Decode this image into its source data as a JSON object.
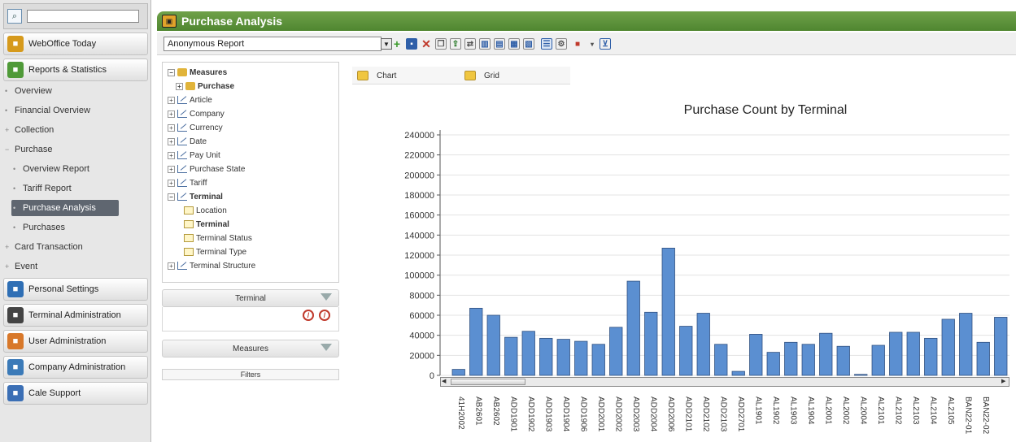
{
  "sidebar": {
    "search_value": "",
    "sections": [
      {
        "label": "WebOffice Today",
        "icon": "weboffice-icon",
        "color": "#d69a1c"
      },
      {
        "label": "Reports & Statistics",
        "icon": "bar-chart-icon",
        "color": "#4f9a38"
      }
    ],
    "sub_items": [
      {
        "label": "Overview",
        "level": 1
      },
      {
        "label": "Financial Overview",
        "level": 1
      },
      {
        "label": "Collection",
        "level": 1,
        "expand": "+"
      },
      {
        "label": "Purchase",
        "level": 1,
        "expand": "-"
      },
      {
        "label": "Overview Report",
        "level": 2
      },
      {
        "label": "Tariff Report",
        "level": 2
      },
      {
        "label": "Purchase Analysis",
        "level": 2,
        "active": true
      },
      {
        "label": "Purchases",
        "level": 2
      },
      {
        "label": "Card Transaction",
        "level": 1,
        "expand": "+"
      },
      {
        "label": "Event",
        "level": 1,
        "expand": "+"
      }
    ],
    "bottom_sections": [
      {
        "label": "Personal Settings",
        "icon": "settings-icon",
        "color": "#2f6fb5"
      },
      {
        "label": "Terminal Administration",
        "icon": "terminal-icon",
        "color": "#444444"
      },
      {
        "label": "User Administration",
        "icon": "users-icon",
        "color": "#d8782a"
      },
      {
        "label": "Company Administration",
        "icon": "building-icon",
        "color": "#3b7ab8"
      },
      {
        "label": "Cale Support",
        "icon": "support-icon",
        "color": "#3b6fb5"
      }
    ]
  },
  "header": {
    "title": "Purchase Analysis",
    "accent": "#5a9a3c"
  },
  "toolbar": {
    "report_select": "Anonymous Report"
  },
  "tree": [
    {
      "label": "Measures",
      "kind": "meas",
      "pm": "-",
      "indent": 0,
      "bold": true
    },
    {
      "label": "Purchase",
      "kind": "meas",
      "pm": "+",
      "indent": 1,
      "bold": true
    },
    {
      "label": "Article",
      "kind": "axis",
      "pm": "+",
      "indent": 0
    },
    {
      "label": "Company",
      "kind": "axis",
      "pm": "+",
      "indent": 0
    },
    {
      "label": "Currency",
      "kind": "axis",
      "pm": "+",
      "indent": 0
    },
    {
      "label": "Date",
      "kind": "axis",
      "pm": "+",
      "indent": 0
    },
    {
      "label": "Pay Unit",
      "kind": "axis",
      "pm": "+",
      "indent": 0
    },
    {
      "label": "Purchase State",
      "kind": "axis",
      "pm": "+",
      "indent": 0
    },
    {
      "label": "Tariff",
      "kind": "axis",
      "pm": "+",
      "indent": 0
    },
    {
      "label": "Terminal",
      "kind": "axis",
      "pm": "-",
      "indent": 0,
      "bold": true
    },
    {
      "label": "Location",
      "kind": "lvl",
      "pm": "",
      "indent": 2
    },
    {
      "label": "Terminal",
      "kind": "lvl",
      "pm": "",
      "indent": 2,
      "bold": true
    },
    {
      "label": "Terminal Status",
      "kind": "lvl",
      "pm": "",
      "indent": 2
    },
    {
      "label": "Terminal Type",
      "kind": "lvl",
      "pm": "",
      "indent": 2
    },
    {
      "label": "Terminal Structure",
      "kind": "axis",
      "pm": "+",
      "indent": 0
    }
  ],
  "panels": {
    "rows": "Terminal",
    "columns": "Measures",
    "filters": "Filters"
  },
  "tabs": {
    "chart": "Chart",
    "grid": "Grid"
  },
  "chart_data": {
    "type": "bar",
    "title": "Purchase Count by Terminal",
    "xlabel": "",
    "ylabel": "",
    "ylim": [
      0,
      240000
    ],
    "yticks": [
      0,
      20000,
      40000,
      60000,
      80000,
      100000,
      120000,
      140000,
      160000,
      180000,
      200000,
      220000,
      240000
    ],
    "grid": true,
    "bar_color": "#5b8fd1",
    "categories": [
      "41H2002",
      "AB2601",
      "AB2602",
      "ADD1901",
      "ADD1902",
      "ADD1903",
      "ADD1904",
      "ADD1906",
      "ADD2001",
      "ADD2002",
      "ADD2003",
      "ADD2004",
      "ADD2006",
      "ADD2101",
      "ADD2102",
      "ADD2103",
      "ADD2701",
      "AL1901",
      "AL1902",
      "AL1903",
      "AL1904",
      "AL2001",
      "AL2002",
      "AL2004",
      "AL2101",
      "AL2102",
      "AL2103",
      "AL2104",
      "AL2105",
      "BAN22-01",
      "BAN22-02",
      ""
    ],
    "values": [
      6000,
      67000,
      60000,
      38000,
      44000,
      37000,
      36000,
      34000,
      31000,
      48000,
      94000,
      63000,
      127000,
      49000,
      62000,
      31000,
      4000,
      41000,
      23000,
      33000,
      31000,
      42000,
      29000,
      1000,
      30000,
      43000,
      43000,
      37000,
      56000,
      62000,
      33000,
      58000
    ]
  }
}
